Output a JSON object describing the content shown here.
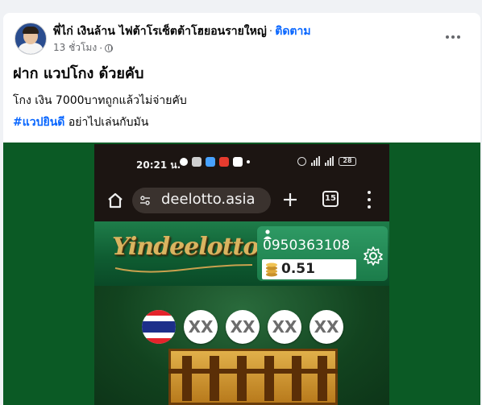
{
  "post": {
    "author": "พี่ไก่ เงินล้าน ไฟต้าโรเซ็ตต้าโฮยอนรายใหญ่",
    "separator": "·",
    "follow_label": "ติดตาม",
    "time": "13 ชั่วโมง",
    "meta_separator": "·",
    "headline": "ฝาก แวปโกง ด้วยคับ",
    "body_line": "โกง เงิน 7000บาทถูกแล้วไม่จ่ายคับ",
    "hashtag": "#แวปยินดี",
    "hashtag_suffix": " อย่าไปเล่นกับมัน"
  },
  "screenshot": {
    "status_time": "20:21 น.",
    "battery": "28",
    "url": "deelotto.asia",
    "tab_count": "15",
    "logo": "Yindeelotto",
    "phone_number": "0950363108",
    "balance": "0.51",
    "balls": [
      "XX",
      "XX",
      "XX",
      "XX"
    ]
  },
  "colors": {
    "link": "#0866ff",
    "media_bg": "#0b5a25",
    "site_green": "#1b7c4a"
  },
  "icons": [
    "globe-icon",
    "more-icon",
    "home-icon",
    "tune-icon",
    "plus-icon",
    "tabs-icon",
    "kebab-icon",
    "user-icon",
    "coins-icon",
    "settings-icon",
    "thai-flag-icon"
  ]
}
